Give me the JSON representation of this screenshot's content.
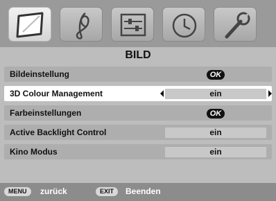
{
  "tabs": [
    {
      "icon": "picture-icon",
      "active": true
    },
    {
      "icon": "music-note-icon",
      "active": false
    },
    {
      "icon": "settings-sliders-icon",
      "active": false
    },
    {
      "icon": "clock-icon",
      "active": false
    },
    {
      "icon": "wrench-icon",
      "active": false
    }
  ],
  "menu": {
    "title": "BILD",
    "rows": [
      {
        "label": "Bildeinstellung",
        "value": "OK"
      },
      {
        "label": "3D Colour Management",
        "value": "ein"
      },
      {
        "label": "Farbeinstellungen",
        "value": "OK"
      },
      {
        "label": "Active Backlight Control",
        "value": "ein"
      },
      {
        "label": "Kino Modus",
        "value": "ein"
      }
    ]
  },
  "footer": {
    "menu_key": "MENU",
    "menu_action": "zurück",
    "exit_key": "EXIT",
    "exit_action": "Beenden"
  },
  "colors": {
    "panel_bg": "#bdbdbd",
    "selected_row_bg": "#ffffff",
    "footer_bg": "#8c8c8c",
    "ok_badge_bg": "#111111"
  }
}
